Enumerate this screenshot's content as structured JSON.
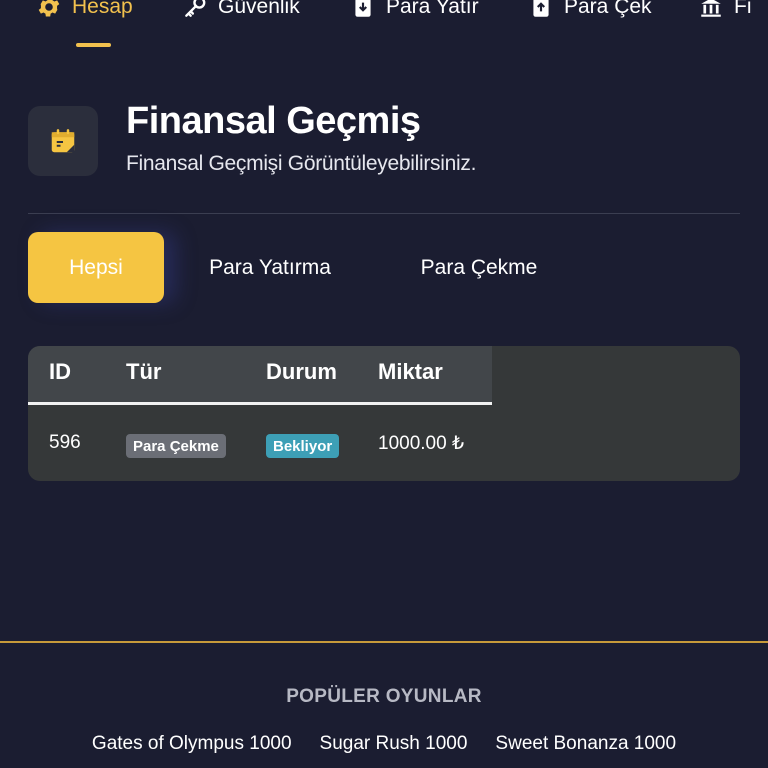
{
  "nav": {
    "items": [
      {
        "label": "Hesap",
        "icon": "gear-icon",
        "active": true
      },
      {
        "label": "Güvenlik",
        "icon": "key-icon",
        "active": false
      },
      {
        "label": "Para Yatır",
        "icon": "wallet-in-icon",
        "active": false
      },
      {
        "label": "Para Çek",
        "icon": "wallet-out-icon",
        "active": false
      },
      {
        "label": "Fi",
        "icon": "bank-icon",
        "active": false
      }
    ]
  },
  "header": {
    "title": "Finansal Geçmiş",
    "subtitle": "Finansal Geçmişi Görüntüleyebilirsiniz.",
    "icon": "calendar-icon"
  },
  "tabs": [
    {
      "label": "Hepsi",
      "active": true
    },
    {
      "label": "Para Yatırma",
      "active": false
    },
    {
      "label": "Para Çekme",
      "active": false
    }
  ],
  "table": {
    "columns": [
      "ID",
      "Tür",
      "Durum",
      "Miktar"
    ],
    "rows": [
      {
        "id": "596",
        "type": "Para Çekme",
        "status": "Bekliyor",
        "amount": "1000.00 ₺"
      }
    ]
  },
  "footer": {
    "heading": "POPÜLER OYUNLAR",
    "games": [
      "Gates of Olympus 1000",
      "Sugar Rush 1000",
      "Sweet Bonanza 1000"
    ]
  },
  "colors": {
    "background": "#1b1d31",
    "accent": "#f5c542",
    "status_badge": "#3d9fb6",
    "type_badge": "#6b6e76"
  }
}
